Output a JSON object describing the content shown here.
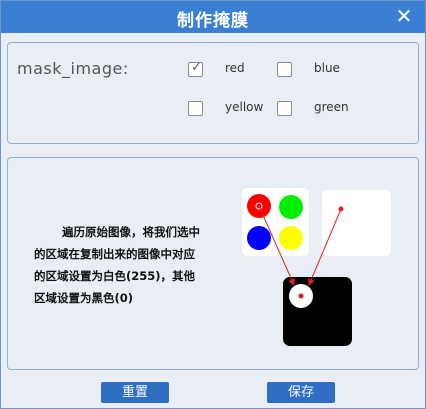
{
  "window": {
    "title": "制作掩膜"
  },
  "icons": {
    "close": "close-icon",
    "check": "checkmark-icon"
  },
  "mask": {
    "label": "mask_image:",
    "options": [
      {
        "label": "red",
        "checked": true
      },
      {
        "label": "blue",
        "checked": false
      },
      {
        "label": "yellow",
        "checked": false
      },
      {
        "label": "green",
        "checked": false
      }
    ]
  },
  "description": {
    "line1": "遍历原始图像，将我们选中",
    "line2": "的区域在复制出来的图像中对应",
    "line3": "的区域设置为白色(255)，其他",
    "line4": "区域设置为黑色(0)"
  },
  "illustration": {
    "circle_colors": [
      "#ff0000",
      "#00ee00",
      "#0000ff",
      "#ffff00"
    ],
    "arrow_color": "#e02020"
  },
  "buttons": {
    "reset": "重置",
    "save": "保存"
  }
}
